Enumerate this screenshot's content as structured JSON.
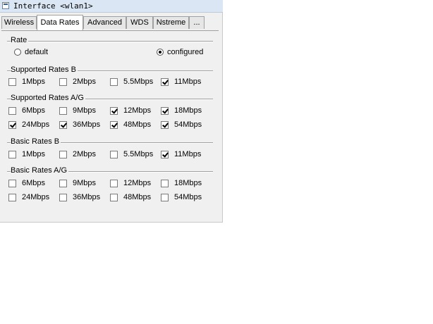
{
  "window": {
    "title": "Interface <wlan1>"
  },
  "tabs": [
    {
      "label": "Wireless",
      "active": false
    },
    {
      "label": "Data Rates",
      "active": true
    },
    {
      "label": "Advanced",
      "active": false
    },
    {
      "label": "WDS",
      "active": false
    },
    {
      "label": "Nstreme",
      "active": false
    },
    {
      "label": "...",
      "active": false
    }
  ],
  "rate": {
    "title": "Rate",
    "options": [
      {
        "label": "default",
        "selected": false
      },
      {
        "label": "configured",
        "selected": true
      }
    ]
  },
  "supported_b": {
    "title": "Supported Rates B",
    "items": [
      {
        "label": "1Mbps",
        "checked": false
      },
      {
        "label": "2Mbps",
        "checked": false
      },
      {
        "label": "5.5Mbps",
        "checked": false
      },
      {
        "label": "11Mbps",
        "checked": true
      }
    ]
  },
  "supported_ag": {
    "title": "Supported Rates A/G",
    "items": [
      {
        "label": "6Mbps",
        "checked": false
      },
      {
        "label": "9Mbps",
        "checked": false
      },
      {
        "label": "12Mbps",
        "checked": true
      },
      {
        "label": "18Mbps",
        "checked": true
      },
      {
        "label": "24Mbps",
        "checked": true
      },
      {
        "label": "36Mbps",
        "checked": true
      },
      {
        "label": "48Mbps",
        "checked": true
      },
      {
        "label": "54Mbps",
        "checked": true
      }
    ]
  },
  "basic_b": {
    "title": "Basic Rates B",
    "items": [
      {
        "label": "1Mbps",
        "checked": false
      },
      {
        "label": "2Mbps",
        "checked": false
      },
      {
        "label": "5.5Mbps",
        "checked": false
      },
      {
        "label": "11Mbps",
        "checked": true
      }
    ]
  },
  "basic_ag": {
    "title": "Basic Rates A/G",
    "items": [
      {
        "label": "6Mbps",
        "checked": false
      },
      {
        "label": "9Mbps",
        "checked": false
      },
      {
        "label": "12Mbps",
        "checked": false
      },
      {
        "label": "18Mbps",
        "checked": false
      },
      {
        "label": "24Mbps",
        "checked": false
      },
      {
        "label": "36Mbps",
        "checked": false
      },
      {
        "label": "48Mbps",
        "checked": false
      },
      {
        "label": "54Mbps",
        "checked": false
      }
    ]
  }
}
